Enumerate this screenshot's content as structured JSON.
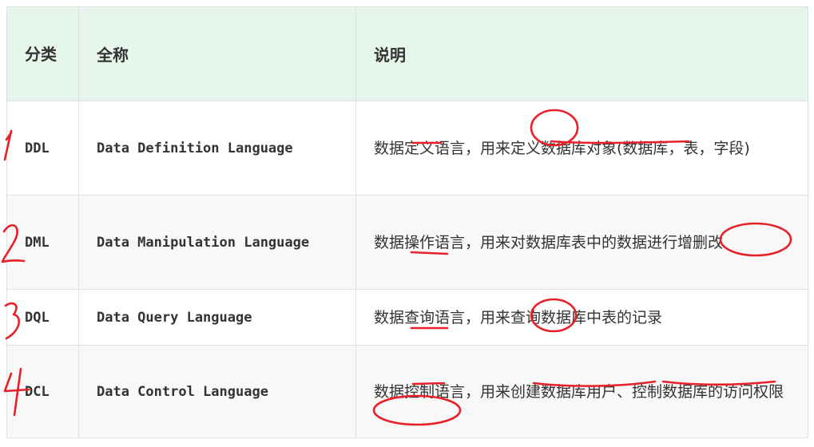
{
  "table": {
    "headers": [
      "分类",
      "全称",
      "说明"
    ],
    "rows": [
      {
        "abbr": "DDL",
        "full": "Data Definition Language",
        "desc": "数据定义语言，用来定义数据库对象(数据库，表，字段)"
      },
      {
        "abbr": "DML",
        "full": "Data Manipulation Language",
        "desc": "数据操作语言，用来对数据库表中的数据进行增删改"
      },
      {
        "abbr": "DQL",
        "full": "Data Query Language",
        "desc": "数据查询语言，用来查询数据库中表的记录"
      },
      {
        "abbr": "DCL",
        "full": "Data Control Language",
        "desc": "数据控制语言，用来创建数据库用户、控制数据库的访问权限"
      }
    ]
  },
  "annotations": {
    "color": "#e8202a",
    "numbers": [
      "1",
      "2",
      "3",
      "4"
    ]
  }
}
